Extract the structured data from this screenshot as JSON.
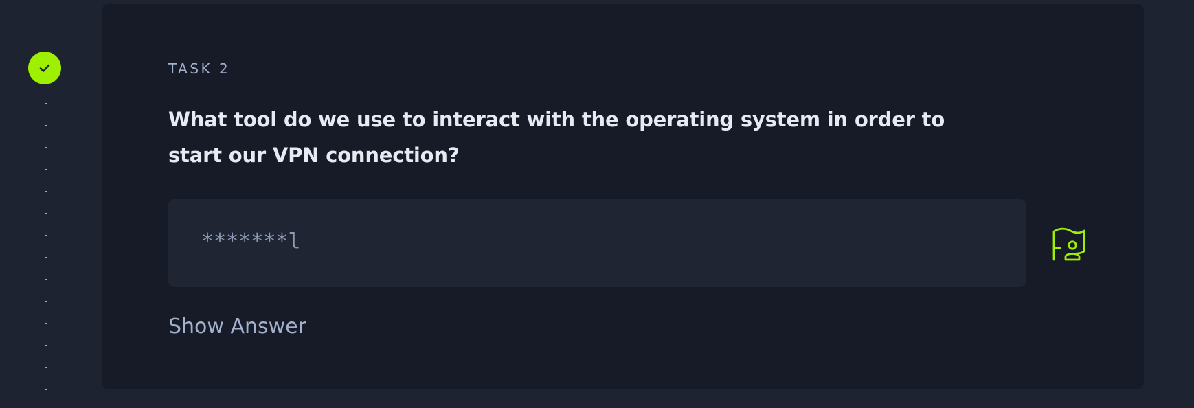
{
  "task": {
    "label": "TASK 2",
    "status_icon": "check-icon",
    "status": "completed",
    "question": "What tool do we use to interact with the operating system in order to start our VPN connection?",
    "answer_masked": "*******l",
    "submit_icon": "flag-icon",
    "show_answer_label": "Show Answer"
  },
  "colors": {
    "accent": "#9fef00",
    "background": "#1d2330",
    "card": "#161b27",
    "input": "#1f2533",
    "question_text": "#e6eaf2",
    "muted_text": "#a4b1cd"
  }
}
